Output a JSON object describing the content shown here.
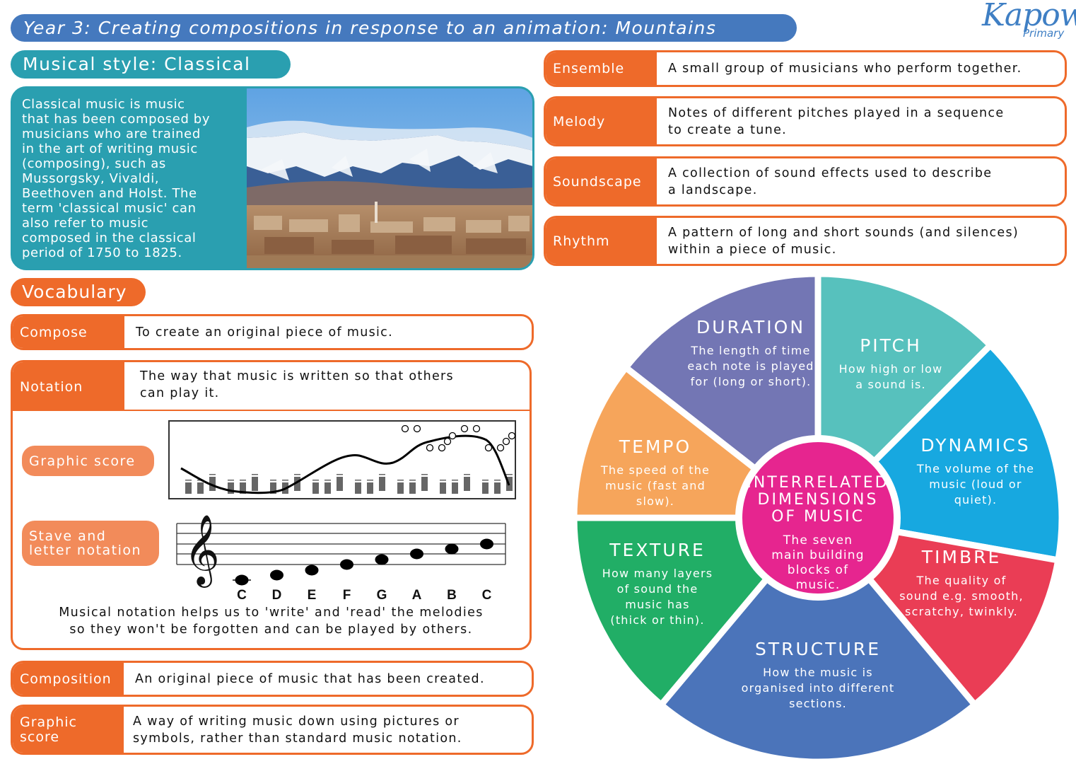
{
  "header": {
    "title": "Year 3: Creating compositions in response to an animation: Mountains",
    "logo_main": "Kapow",
    "logo_sub": "Primary"
  },
  "style": {
    "heading": "Musical style: Classical",
    "lines": [
      "Classical music is music",
      "that has been composed by",
      "musicians who are trained",
      "in the art of writing music",
      "(composing), such as",
      "Mussorgsky, Vivaldi,",
      "Beethoven and Holst. The",
      "term 'classical music' can",
      "also refer to music",
      "composed in the classical",
      "period of 1750 to 1825."
    ],
    "image": "mountain-town-photo"
  },
  "glossary_right": [
    {
      "term": "Ensemble",
      "definition": "A small group of musicians who perform together."
    },
    {
      "term": "Melody",
      "definition_lines": [
        "Notes of different pitches played in a sequence",
        "to create a tune."
      ]
    },
    {
      "term": "Soundscape",
      "definition_lines": [
        "A collection of sound effects used to describe",
        "a landscape."
      ]
    },
    {
      "term": "Rhythm",
      "definition_lines": [
        "A pattern of long and short sounds (and silences)",
        "within a piece of music."
      ]
    }
  ],
  "vocabulary": {
    "heading": "Vocabulary",
    "compose": {
      "term": "Compose",
      "definition": "To create an original piece of music."
    },
    "notation": {
      "term": "Notation",
      "definition_lines": [
        "The way that music is written so that others",
        "can play it."
      ],
      "graphic_score_label": "Graphic score",
      "stave_label_lines": [
        "Stave and",
        "letter notation"
      ],
      "note_letters": [
        "C",
        "D",
        "E",
        "F",
        "G",
        "A",
        "B",
        "C"
      ],
      "caption_lines": [
        "Musical notation helps us to 'write' and 'read' the melodies",
        "so they won't be forgotten and can be played by others."
      ]
    },
    "composition": {
      "term": "Composition",
      "definition": "An original piece of music that has been created."
    },
    "graphic_score": {
      "term_lines": [
        "Graphic",
        "score"
      ],
      "definition_lines": [
        "A way of writing music down using pictures or",
        "symbols, rather than standard music notation."
      ]
    }
  },
  "dimensions": {
    "center_title_lines": [
      "INTERRELATED",
      "DIMENSIONS",
      "OF MUSIC"
    ],
    "center_desc_lines": [
      "The seven",
      "main building",
      "blocks of",
      "music."
    ],
    "center_color": "#e6258f",
    "segments": [
      {
        "name": "DURATION",
        "color": "#7376b4",
        "desc_lines": [
          "The length of time",
          "each note is played",
          "for (long or short)."
        ]
      },
      {
        "name": "PITCH",
        "color": "#57c1bd",
        "desc_lines": [
          "How high or low",
          "a sound is."
        ]
      },
      {
        "name": "DYNAMICS",
        "color": "#17a8e0",
        "desc_lines": [
          "The volume of the",
          "music (loud or",
          "quiet)."
        ]
      },
      {
        "name": "TIMBRE",
        "color": "#ea3d55",
        "desc_lines": [
          "The quality of",
          "sound e.g. smooth,",
          "scratchy, twinkly."
        ]
      },
      {
        "name": "STRUCTURE",
        "color": "#4b74ba",
        "desc_lines": [
          "How the music is",
          "organised into different",
          "sections."
        ]
      },
      {
        "name": "TEXTURE",
        "color": "#21ae66",
        "desc_lines": [
          "How many layers",
          "of sound the",
          "music has",
          "(thick or thin)."
        ]
      },
      {
        "name": "TEMPO",
        "color": "#f6a55b",
        "desc_lines": [
          "The speed of the",
          "music (fast and",
          "slow)."
        ]
      }
    ]
  },
  "colors": {
    "title_blue": "#4579be",
    "teal": "#2a9fb0",
    "orange": "#ee6a2a",
    "light_orange": "#f28b5a"
  }
}
